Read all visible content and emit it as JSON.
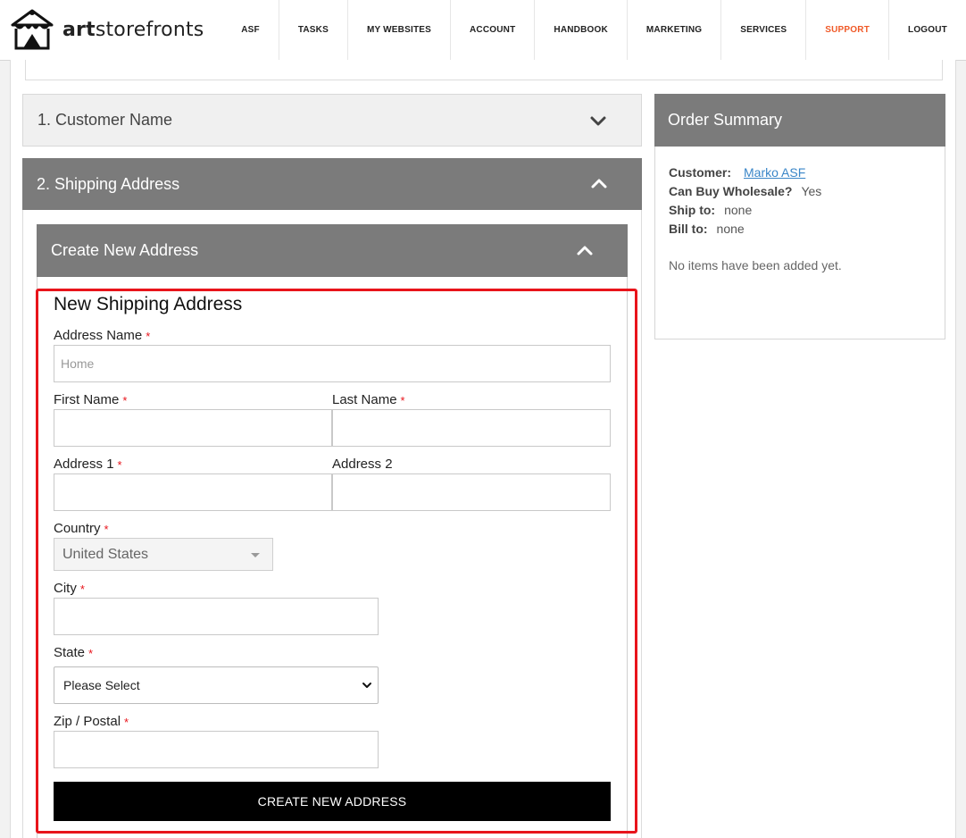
{
  "brand": {
    "name_bold": "art",
    "name_rest": "storefronts"
  },
  "nav": [
    {
      "label": "ASF",
      "active": false
    },
    {
      "label": "TASKS",
      "active": false
    },
    {
      "label": "MY WEBSITES",
      "active": false
    },
    {
      "label": "ACCOUNT",
      "active": false
    },
    {
      "label": "HANDBOOK",
      "active": false
    },
    {
      "label": "MARKETING",
      "active": false
    },
    {
      "label": "SERVICES",
      "active": false
    },
    {
      "label": "SUPPORT",
      "active": true
    },
    {
      "label": "LOGOUT",
      "active": false
    }
  ],
  "checkout": {
    "step1": {
      "title": "1. Customer Name",
      "icon": "chevron-down-icon"
    },
    "step2": {
      "title": "2. Shipping Address",
      "icon": "chevron-up-icon"
    },
    "create_section": {
      "title": "Create New Address",
      "icon": "chevron-up-icon"
    }
  },
  "form": {
    "title": "New Shipping Address",
    "required_mark": "*",
    "address_name": {
      "label": "Address Name",
      "placeholder": "Home",
      "value": ""
    },
    "first_name": {
      "label": "First Name",
      "value": ""
    },
    "last_name": {
      "label": "Last Name",
      "value": ""
    },
    "address1": {
      "label": "Address 1",
      "value": ""
    },
    "address2": {
      "label": "Address 2",
      "value": ""
    },
    "country": {
      "label": "Country",
      "value": "United States"
    },
    "city": {
      "label": "City",
      "value": ""
    },
    "state": {
      "label": "State",
      "value": "Please Select"
    },
    "zip": {
      "label": "Zip / Postal",
      "value": ""
    },
    "submit_label": "CREATE NEW ADDRESS"
  },
  "summary": {
    "title": "Order Summary",
    "customer_label": "Customer:",
    "customer_value": "Marko ASF",
    "wholesale_label": "Can Buy Wholesale?",
    "wholesale_value": "Yes",
    "ship_label": "Ship to:",
    "ship_value": "none",
    "bill_label": "Bill to:",
    "bill_value": "none",
    "empty_message": "No items have been added yet."
  },
  "colors": {
    "accent": "#f05a28",
    "panel": "#7b7b7b",
    "required": "#e8141b",
    "highlight": "#e8141b",
    "link": "#3a86c8"
  }
}
